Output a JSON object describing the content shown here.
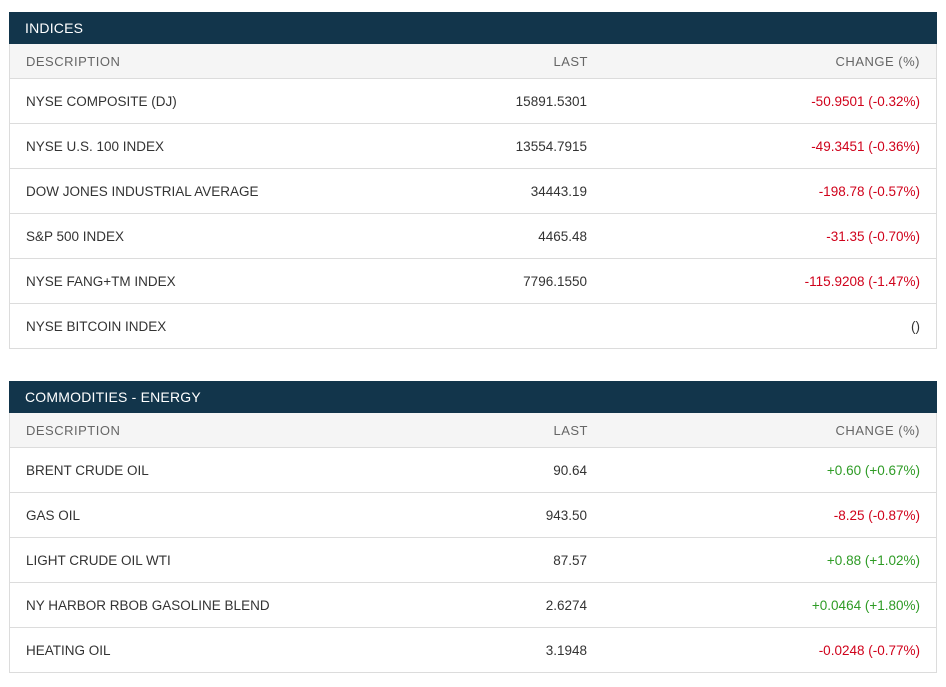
{
  "colors": {
    "header_bg": "#12354b",
    "negative": "#d0021b",
    "positive": "#2e9b25"
  },
  "columns": {
    "description": "DESCRIPTION",
    "last": "LAST",
    "change": "CHANGE (%)"
  },
  "indices": {
    "title": "INDICES",
    "rows": [
      {
        "description": "NYSE COMPOSITE (DJ)",
        "last": "15891.5301",
        "change": "-50.9501 (-0.32%)",
        "direction": "neg"
      },
      {
        "description": "NYSE U.S. 100 INDEX",
        "last": "13554.7915",
        "change": "-49.3451 (-0.36%)",
        "direction": "neg"
      },
      {
        "description": "DOW JONES INDUSTRIAL AVERAGE",
        "last": "34443.19",
        "change": "-198.78 (-0.57%)",
        "direction": "neg"
      },
      {
        "description": "S&P 500 INDEX",
        "last": "4465.48",
        "change": "-31.35 (-0.70%)",
        "direction": "neg"
      },
      {
        "description": "NYSE FANG+TM INDEX",
        "last": "7796.1550",
        "change": "-115.9208 (-1.47%)",
        "direction": "neg"
      },
      {
        "description": "NYSE BITCOIN INDEX",
        "last": "",
        "change": "()",
        "direction": "neutral"
      }
    ]
  },
  "energy": {
    "title": "COMMODITIES - ENERGY",
    "rows": [
      {
        "description": "BRENT CRUDE OIL",
        "last": "90.64",
        "change": "+0.60 (+0.67%)",
        "direction": "pos"
      },
      {
        "description": "GAS OIL",
        "last": "943.50",
        "change": "-8.25 (-0.87%)",
        "direction": "neg"
      },
      {
        "description": "LIGHT CRUDE OIL WTI",
        "last": "87.57",
        "change": "+0.88 (+1.02%)",
        "direction": "pos"
      },
      {
        "description": "NY HARBOR RBOB GASOLINE BLEND",
        "last": "2.6274",
        "change": "+0.0464 (+1.80%)",
        "direction": "pos"
      },
      {
        "description": "HEATING OIL",
        "last": "3.1948",
        "change": "-0.0248 (-0.77%)",
        "direction": "neg"
      }
    ]
  }
}
